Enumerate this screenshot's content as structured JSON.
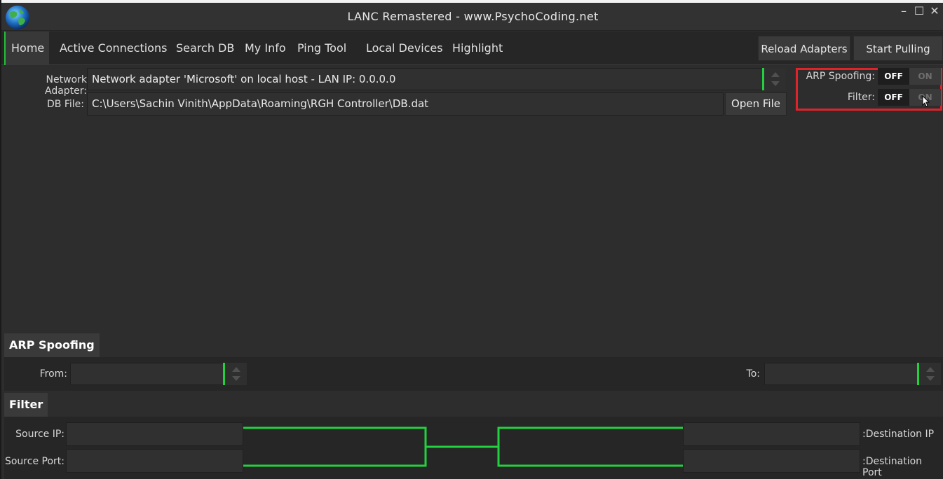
{
  "window": {
    "title": "LANC Remastered - www.PsychoCoding.net",
    "controls": {
      "minimize": "–",
      "maximize": "☐",
      "close": "✕"
    }
  },
  "nav": {
    "items": [
      {
        "label": "Home"
      },
      {
        "label": "Active Connections"
      },
      {
        "label": "Search DB"
      },
      {
        "label": "My Info"
      },
      {
        "label": "Ping Tool"
      },
      {
        "label": "Local Devices"
      },
      {
        "label": "Highlight"
      }
    ],
    "reload_adapters": "Reload Adapters",
    "start_pulling": "Start Pulling"
  },
  "settings": {
    "network_adapter_label": "Network Adapter:",
    "network_adapter_value": "Network adapter 'Microsoft' on local host - LAN IP: 0.0.0.0",
    "db_file_label": "DB File:",
    "db_file_value": "C:\\Users\\Sachin Vinith\\AppData\\Roaming\\RGH Controller\\DB.dat",
    "open_file": "Open File"
  },
  "toggles": {
    "arp_label": "ARP Spoofing:",
    "filter_label": "Filter:",
    "off": "OFF",
    "on": "ON"
  },
  "arp_section": {
    "title": "ARP Spoofing",
    "from_label": "From:",
    "to_label": "To:"
  },
  "filter_section": {
    "title": "Filter",
    "source_ip_label": "Source IP:",
    "source_port_label": "Source Port:",
    "dest_ip_label": ":Destination IP",
    "dest_port_label": ":Destination Port"
  },
  "colors": {
    "accent_green": "#22d040",
    "highlight_red": "#e0232b",
    "background": "#2d2d2d"
  }
}
